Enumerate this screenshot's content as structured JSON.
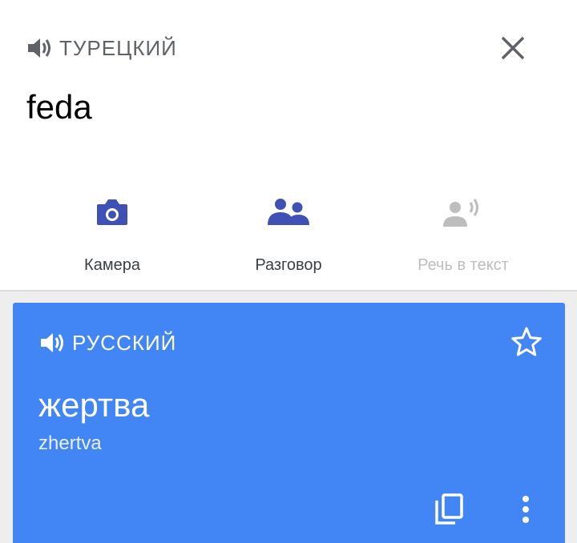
{
  "source": {
    "language_label": "ТУРЕЦКИЙ",
    "text": "feda",
    "speaker_icon": "speaker-icon",
    "close_icon": "close-icon"
  },
  "tools": [
    {
      "label": "Камера",
      "icon": "camera-icon",
      "enabled": true
    },
    {
      "label": "Разговор",
      "icon": "conversation-icon",
      "enabled": true
    },
    {
      "label": "Речь в текст",
      "icon": "transcribe-icon",
      "enabled": false
    }
  ],
  "result": {
    "language_label": "РУССКИЙ",
    "translation": "жертва",
    "transliteration": "zhertva",
    "star_icon": "star-outline-icon",
    "copy_icon": "copy-icon",
    "more_icon": "more-vert-icon"
  },
  "colors": {
    "accent": "#3f51b5",
    "card": "#4285f4",
    "disabled": "#bdbdbd",
    "label_grey": "#5f6368"
  }
}
